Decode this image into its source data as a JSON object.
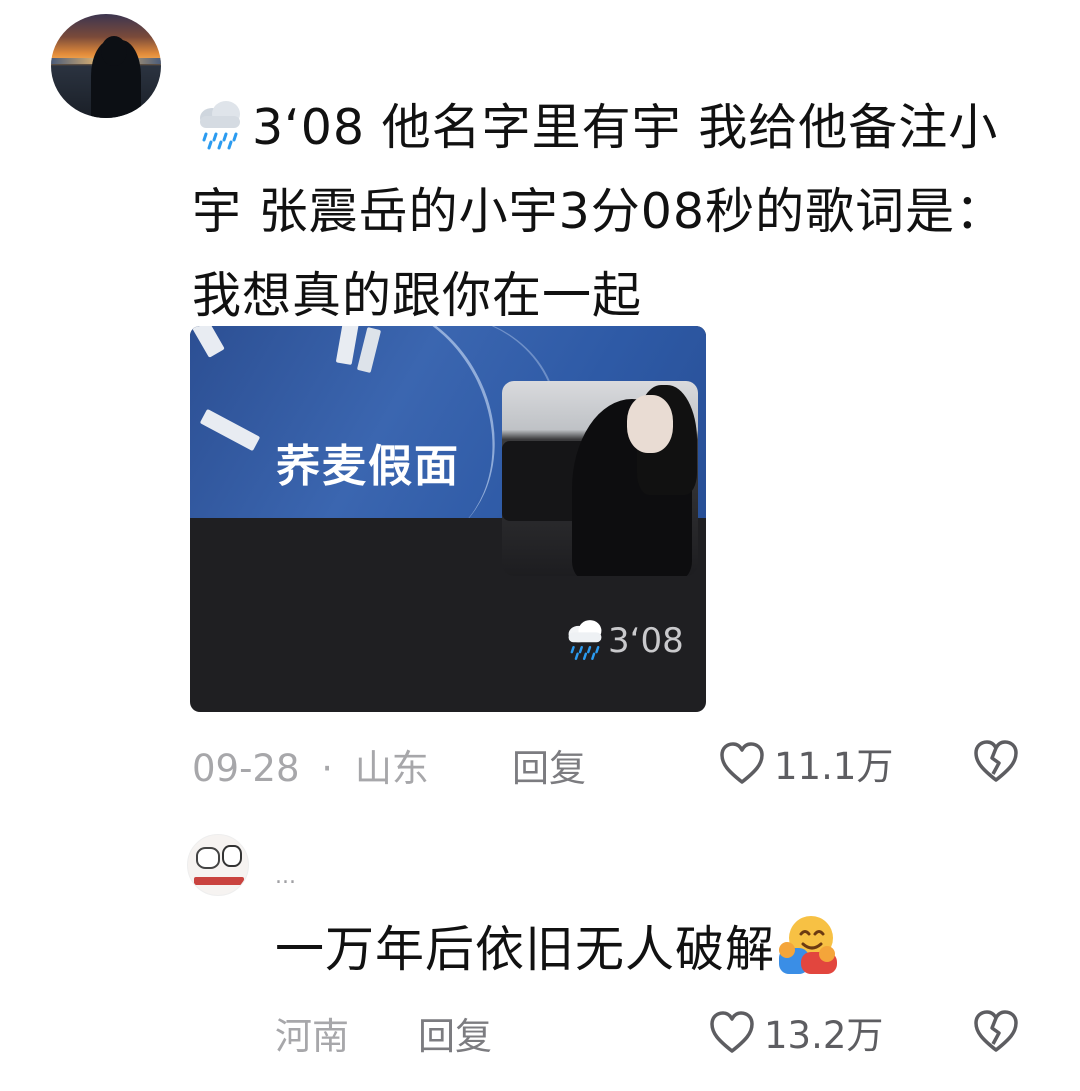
{
  "main_comment": {
    "text": "3‘08  他名字里有宇 我给他备注小宇 张震岳的小宇3分08秒的歌词是：我想真的跟你在一起",
    "leading_icon": "rain-cloud-emoji",
    "media": {
      "title": "荞麦假面",
      "tag_icon": "rain-cloud-emoji",
      "tag_text": "3‘08"
    },
    "date": "09-28",
    "separator": "·",
    "location": "山东",
    "reply_label": "回复",
    "like_count": "11.1万",
    "like_icon": "heart-outline-icon",
    "dislike_icon": "broken-heart-icon"
  },
  "reply_comment": {
    "username": "...",
    "text": "一万年后依旧无人破解",
    "trailing_icon": "hugging-face-emoji",
    "location": "河南",
    "reply_label": "回复",
    "like_count": "13.2万",
    "like_icon": "heart-outline-icon",
    "dislike_icon": "broken-heart-icon"
  },
  "colors": {
    "text_primary": "#111111",
    "text_secondary": "#a7a7aa",
    "action_text": "#7c7c80",
    "card_dark": "#1f1f22",
    "card_blue": "#2e5aa6"
  }
}
